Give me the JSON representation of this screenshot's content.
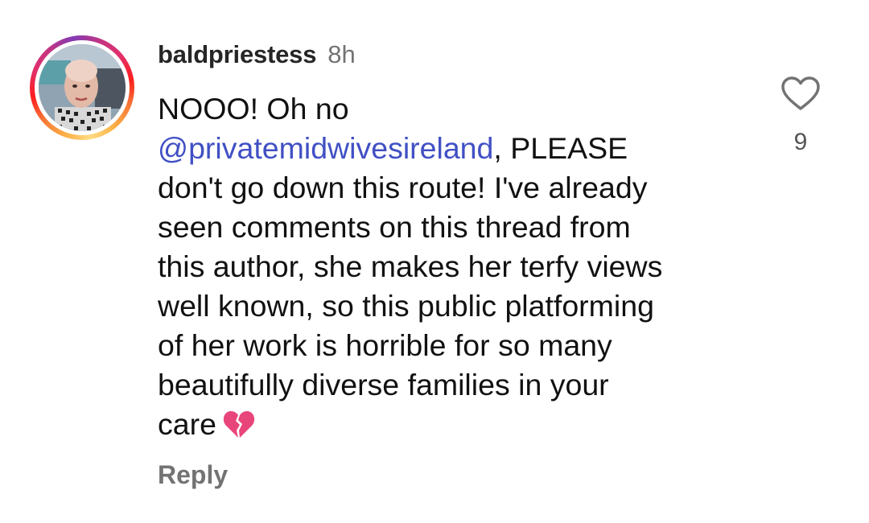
{
  "comment": {
    "username": "baldpriestess",
    "timestamp": "8h",
    "lines": [
      {
        "text": "NOOO! Oh no"
      },
      {
        "mention": "@privatemidwivesireland",
        "rest": ", PLEASE"
      },
      {
        "text": "don't go down this route! I've already"
      },
      {
        "text": "seen comments on this thread from"
      },
      {
        "text": "this author, she makes her terfy views"
      },
      {
        "text": "well known, so this public platforming"
      },
      {
        "text": "of her work is horrible for so many"
      },
      {
        "text": "beautifully diverse families in your"
      },
      {
        "text": "care",
        "emoji": "broken-heart-icon"
      }
    ],
    "reply_label": "Reply",
    "like_count": "9",
    "like_icon": "heart-outline-icon",
    "avatar_ring_colors": [
      "#fcaf45",
      "#f77737",
      "#fd1d1d",
      "#e1306c",
      "#c13584",
      "#833ab4"
    ],
    "mention_color": "#4150c4"
  }
}
